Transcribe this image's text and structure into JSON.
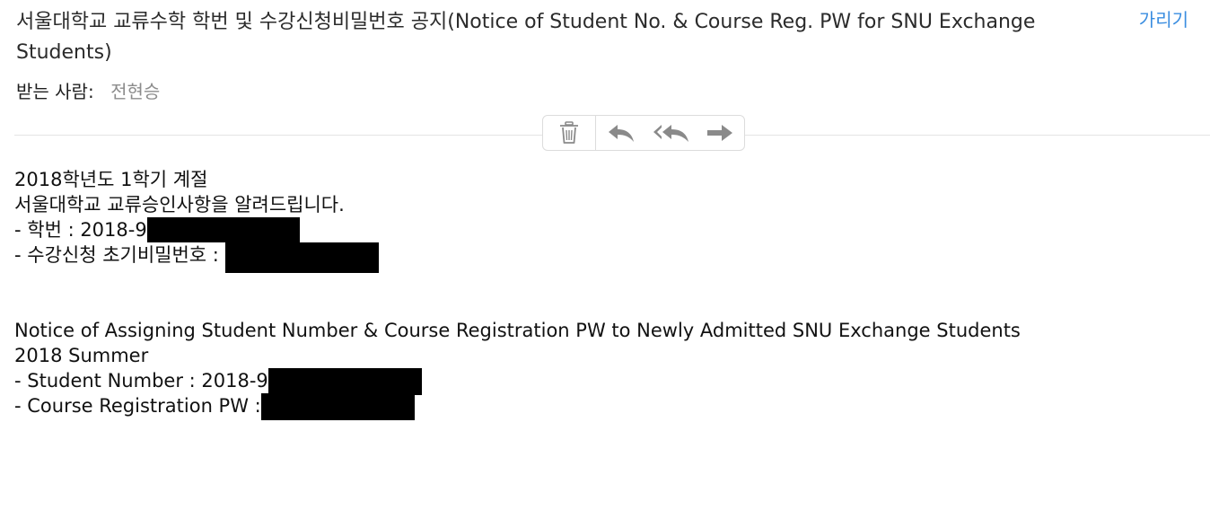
{
  "header": {
    "subject": "서울대학교 교류수학 학번 및 수강신청비밀번호 공지(Notice of Student No. & Course Reg. PW for SNU Exchange Students)",
    "hide_label": "가리기",
    "to_label": "받는 사람:",
    "to_name": "전현승"
  },
  "toolbar": {
    "icons": [
      "trash-icon",
      "reply-icon",
      "reply-all-icon",
      "forward-icon"
    ]
  },
  "message": {
    "kr_title": "2018학년도 1학기 계절",
    "kr_intro": "서울대학교 교류승인사항을 알려드립니다.",
    "kr_student_no_label": "- 학번 : 2018-9",
    "kr_pw_label": "- 수강신청 초기비밀번호 :",
    "en_title": "Notice of Assigning Student Number & Course Registration PW to Newly Admitted SNU Exchange Students",
    "en_term": "2018 Summer",
    "en_student_no_label": "- Student Number : 2018-9",
    "en_pw_label": "- Course Registration PW :"
  },
  "colors": {
    "link": "#3a8de0",
    "muted": "#8c8c8c",
    "icon": "#8a8a8a",
    "redaction": "#000000"
  }
}
